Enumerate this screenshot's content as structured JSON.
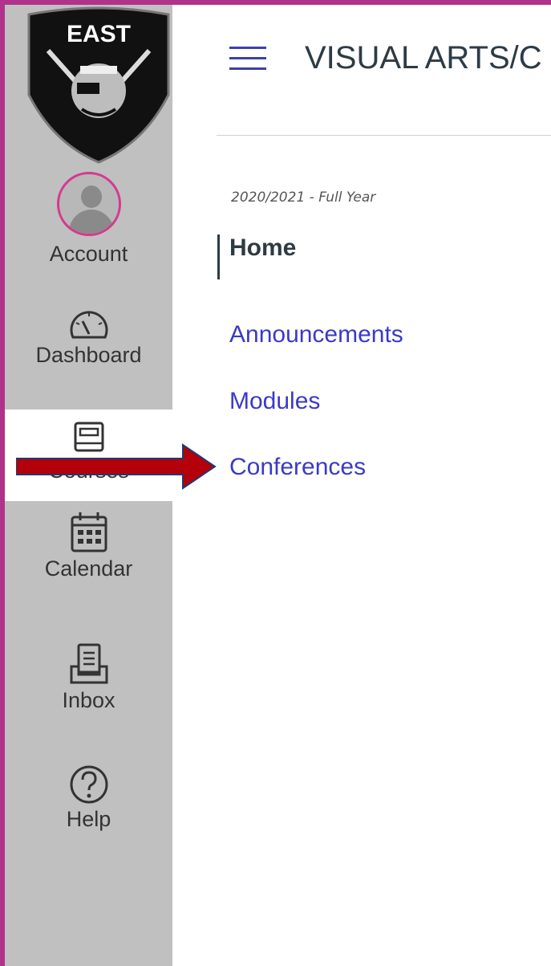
{
  "logo": {
    "text": "EAST"
  },
  "global_nav": {
    "items": [
      {
        "label": "Account",
        "icon": "avatar"
      },
      {
        "label": "Dashboard",
        "icon": "speedometer-icon"
      },
      {
        "label": "Courses",
        "icon": "book-icon",
        "active": true
      },
      {
        "label": "Calendar",
        "icon": "calendar-icon"
      },
      {
        "label": "Inbox",
        "icon": "inbox-icon"
      },
      {
        "label": "Help",
        "icon": "help-icon"
      }
    ]
  },
  "header": {
    "course_title": "VISUAL ARTS/C"
  },
  "course_nav": {
    "term": "2020/2021 - Full Year",
    "items": [
      {
        "label": "Home",
        "current": true
      },
      {
        "label": "Announcements"
      },
      {
        "label": "Modules"
      },
      {
        "label": "Conferences"
      }
    ]
  },
  "colors": {
    "accent_border": "#b0328a",
    "sidebar_bg": "#c0c0c0",
    "link": "#3a3ac8",
    "arrow": "#b3000b"
  }
}
